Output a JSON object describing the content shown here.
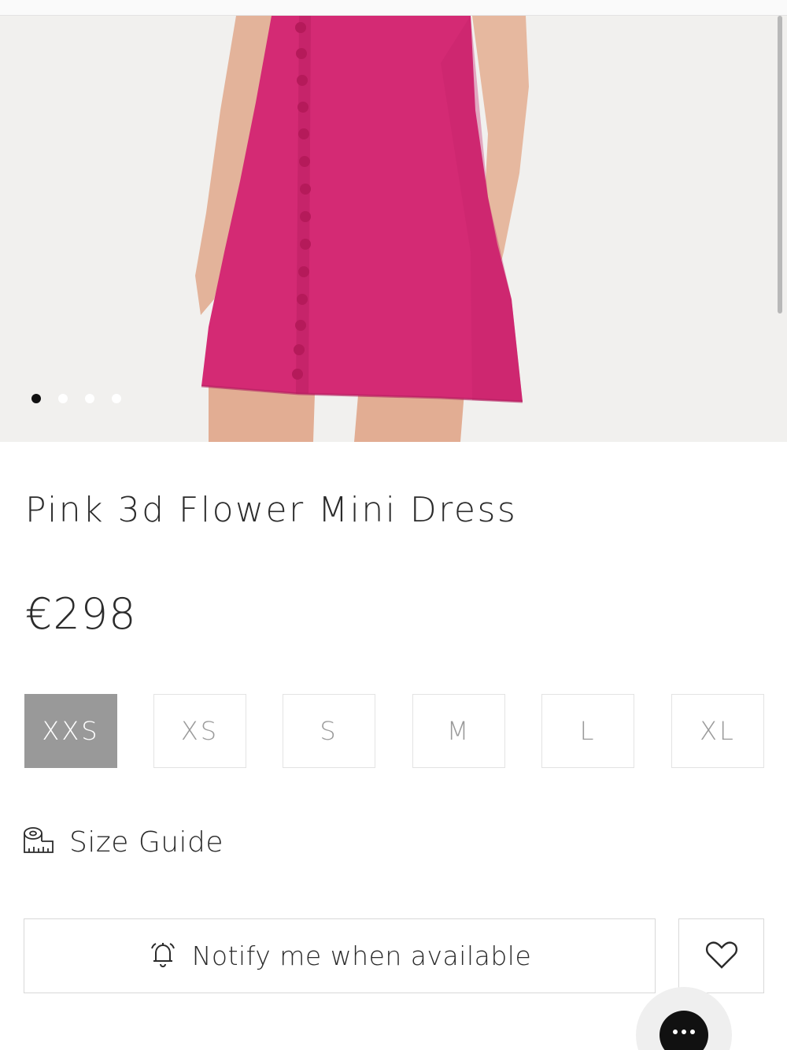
{
  "product": {
    "title": "Pink 3d Flower Mini Dress",
    "price": "€298",
    "image_alt": "pink mini dress photo",
    "carousel": {
      "count": 4,
      "active_index": 0
    }
  },
  "sizes": [
    {
      "label": "XXS",
      "selected": true
    },
    {
      "label": "XS",
      "selected": false
    },
    {
      "label": "S",
      "selected": false
    },
    {
      "label": "M",
      "selected": false
    },
    {
      "label": "L",
      "selected": false
    },
    {
      "label": "XL",
      "selected": false
    }
  ],
  "size_guide": {
    "label": "Size Guide",
    "icon": "measuring-tape-icon"
  },
  "notify": {
    "label": "Notify me when available",
    "icon": "bell-icon"
  },
  "wishlist": {
    "icon": "heart-icon"
  },
  "chat": {
    "icon": "chat-dots-icon"
  },
  "colors": {
    "dress": "#d42a74",
    "selected_size_bg": "#999999",
    "border": "#e3e3e3",
    "text": "#2b2b2b"
  }
}
